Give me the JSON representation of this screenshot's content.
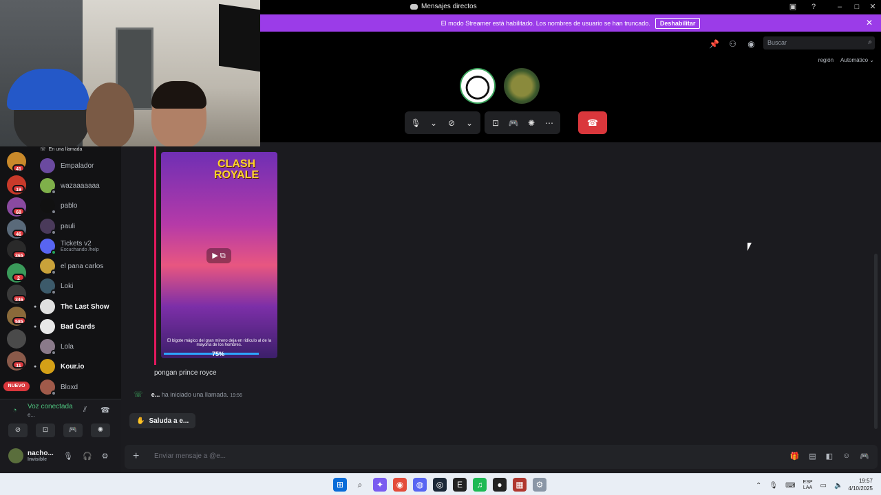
{
  "window": {
    "title": "Mensajes directos"
  },
  "banner": {
    "message": "El modo Streamer está habilitado. Los nombres de usuario se han truncado.",
    "button": "Deshabilitar"
  },
  "search": {
    "placeholder": "Buscar"
  },
  "region": {
    "label": "región",
    "value": "Automático"
  },
  "incall_label": "En una llamada",
  "server_badges": [
    "41",
    "19",
    "68",
    "46",
    "365",
    "2",
    "346",
    "585",
    "11"
  ],
  "nuevo_label": "NUEVO",
  "dms": [
    {
      "name": "Empalador",
      "bold": false,
      "color": "#6b4aa0"
    },
    {
      "name": "wazaaaaaaa",
      "bold": false,
      "color": "#7fb04a"
    },
    {
      "name": "pablo",
      "bold": false,
      "color": "#111111"
    },
    {
      "name": "pauli",
      "bold": false,
      "color": "#4a3a5a"
    },
    {
      "name": "Tickets v2",
      "sub": "Escuchando /help",
      "bold": false,
      "color": "#5865f2"
    },
    {
      "name": "el pana carlos",
      "bold": false,
      "color": "#c9a23a"
    },
    {
      "name": "Loki",
      "bold": false,
      "color": "#3c5a6a"
    },
    {
      "name": "The Last Show",
      "bold": true,
      "color": "#e0e0e0"
    },
    {
      "name": "Bad Cards",
      "bold": true,
      "color": "#e8e8e8"
    },
    {
      "name": "Lola",
      "bold": false,
      "color": "#8a7a8a"
    },
    {
      "name": "Kour.io",
      "bold": true,
      "color": "#d4a017"
    },
    {
      "name": "Bloxd",
      "bold": false,
      "color": "#a05a4a"
    }
  ],
  "voice": {
    "title": "Voz conectada",
    "sub": "e..."
  },
  "user": {
    "name": "nacho...",
    "status": "Invisible"
  },
  "image": {
    "logo": "CLASH ROYALE",
    "caption": "El bigote mágico del gran minero deja en ridículo al de la mayoría de los hombres.",
    "percent": "75%",
    "progress": 0.75
  },
  "messages": {
    "text": "pongan prince royce"
  },
  "call": {
    "who": "e...",
    "text": "ha iniciado una llamada.",
    "time": "19:56"
  },
  "wave": {
    "label": "Saluda a e..."
  },
  "composer": {
    "placeholder": "Enviar mensaje a @e..."
  },
  "tray": {
    "lang1": "ESP",
    "lang2": "LAA",
    "time": "19:57",
    "date": "4/10/2025"
  }
}
